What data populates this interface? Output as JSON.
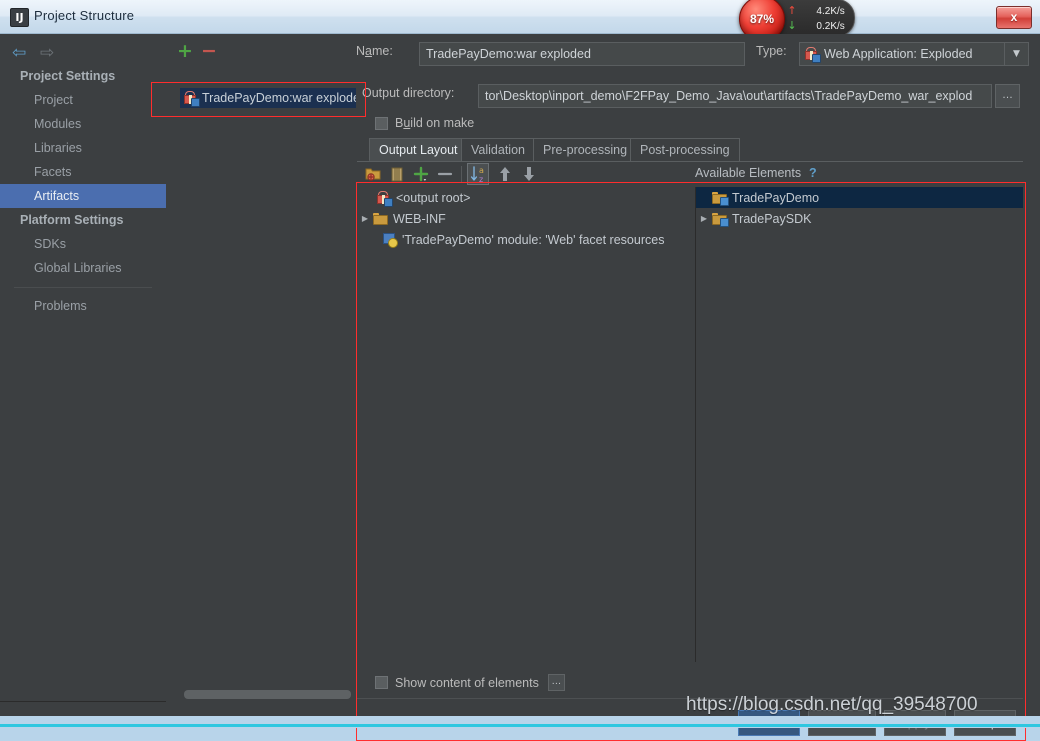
{
  "window": {
    "title": "Project Structure",
    "icon": "intellij-idea-icon",
    "close_label": "x"
  },
  "netspeed": {
    "percent": "87%",
    "upload": "4.2K/s",
    "download": "0.2K/s",
    "up_arrow": "↑",
    "down_arrow": "↓"
  },
  "sidebar": {
    "nav": {
      "back": "⇦",
      "forward": "⇨"
    },
    "groups": [
      {
        "label": "Project Settings"
      },
      {
        "label": "Platform Settings"
      }
    ],
    "items": [
      {
        "label": "Project",
        "selected": false
      },
      {
        "label": "Modules",
        "selected": false
      },
      {
        "label": "Libraries",
        "selected": false
      },
      {
        "label": "Facets",
        "selected": false
      },
      {
        "label": "Artifacts",
        "selected": true
      },
      {
        "label": "SDKs",
        "selected": false
      },
      {
        "label": "Global Libraries",
        "selected": false
      },
      {
        "label": "Problems",
        "selected": false
      }
    ]
  },
  "artifacts_panel": {
    "add_label": "+",
    "remove_label": "−",
    "items": [
      {
        "label": "TradePayDemo:war exploded",
        "icon": "artifact-gift-icon",
        "selected": true
      }
    ]
  },
  "form": {
    "name_label": "Name:",
    "name_value": "TradePayDemo:war exploded",
    "type_label": "Type:",
    "type_value": "Web Application: Exploded",
    "type_icon": "artifact-gift-icon",
    "type_arrow": "▼",
    "output_dir_label": "Output directory:",
    "output_dir_value": "tor\\Desktop\\inport_demo\\F2FPay_Demo_Java\\out\\artifacts\\TradePayDemo_war_explod",
    "output_dir_browse": "…",
    "build_on_make_label": "Build on make",
    "build_on_make_checked": false
  },
  "tabs": [
    {
      "label": "Output Layout",
      "active": true
    },
    {
      "label": "Validation",
      "active": false
    },
    {
      "label": "Pre-processing",
      "active": false
    },
    {
      "label": "Post-processing",
      "active": false
    }
  ],
  "toolbar": {
    "icons": [
      {
        "name": "create-directory-icon"
      },
      {
        "name": "create-archive-icon"
      },
      {
        "name": "add-icon"
      },
      {
        "name": "remove-icon"
      },
      {
        "name": "sort-alphabetically-icon",
        "active": true
      },
      {
        "name": "move-up-icon"
      },
      {
        "name": "move-down-icon"
      }
    ],
    "available_elements_label": "Available Elements",
    "help_label": "?"
  },
  "output_tree": [
    {
      "label": "<output root>",
      "icon": "artifact-gift-icon",
      "indent": 0,
      "expandable": false,
      "selected": false
    },
    {
      "label": "WEB-INF",
      "icon": "folder-icon",
      "indent": 0,
      "expandable": true,
      "expanded": false,
      "selected": false
    },
    {
      "label": "'TradePayDemo' module: 'Web' facet resources",
      "icon": "facet-icon",
      "indent": 1,
      "expandable": false,
      "selected": false
    }
  ],
  "available_tree": [
    {
      "label": "TradePayDemo",
      "icon": "library-folder-icon",
      "indent": 0,
      "expandable": false,
      "selected": true
    },
    {
      "label": "TradePaySDK",
      "icon": "library-folder-icon",
      "indent": 0,
      "expandable": true,
      "expanded": false,
      "selected": false
    }
  ],
  "footer": {
    "show_content_label": "Show content of elements",
    "show_content_checked": false,
    "show_content_more": "…",
    "buttons": [
      {
        "label": "OK",
        "style": "primary"
      },
      {
        "label": "Cancel",
        "style": "normal"
      },
      {
        "label": "Apply",
        "style": "disabled"
      },
      {
        "label": "Help",
        "style": "normal"
      }
    ]
  },
  "watermark": "https://blog.csdn.net/qq_39548700",
  "colors": {
    "window_bg": "#3c3f41",
    "selection_blue": "#4b6eaf",
    "tree_selection": "#0d2742",
    "accent_green": "#4fa544",
    "accent_red": "#c4564f",
    "annotation_red": "#ff2d2d",
    "primary_button": "#365880"
  }
}
